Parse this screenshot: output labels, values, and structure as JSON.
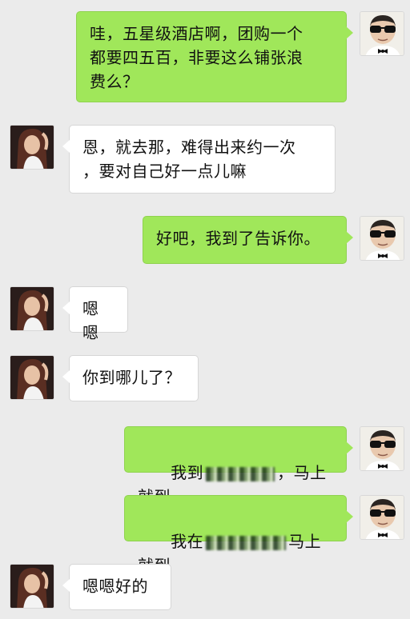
{
  "messages": [
    {
      "side": "right",
      "sender": "male",
      "text": "哇，五星级酒店啊，团购一个\n都要四五百，非要这么铺张浪\n费么？"
    },
    {
      "side": "left",
      "sender": "female",
      "text": "恩，就去那，难得出来约一次\n，要对自己好一点儿嘛"
    },
    {
      "side": "right",
      "sender": "male",
      "text": "好吧，我到了告诉你。"
    },
    {
      "side": "left",
      "sender": "female",
      "text": "嗯嗯"
    },
    {
      "side": "left",
      "sender": "female",
      "text": "你到哪儿了？"
    },
    {
      "side": "right",
      "sender": "male",
      "text_before": "我到",
      "text_after": "，马上就到"
    },
    {
      "side": "right",
      "sender": "male",
      "text_before": "我在",
      "text_after": "马上就到"
    },
    {
      "side": "left",
      "sender": "female",
      "text": "嗯嗯好的"
    }
  ],
  "colors": {
    "background": "#ebebeb",
    "sent_bubble": "#a0e75a",
    "received_bubble": "#ffffff"
  },
  "icons": {
    "male_avatar": "man-sunglasses-bowtie-avatar",
    "female_avatar": "woman-portrait-avatar"
  }
}
